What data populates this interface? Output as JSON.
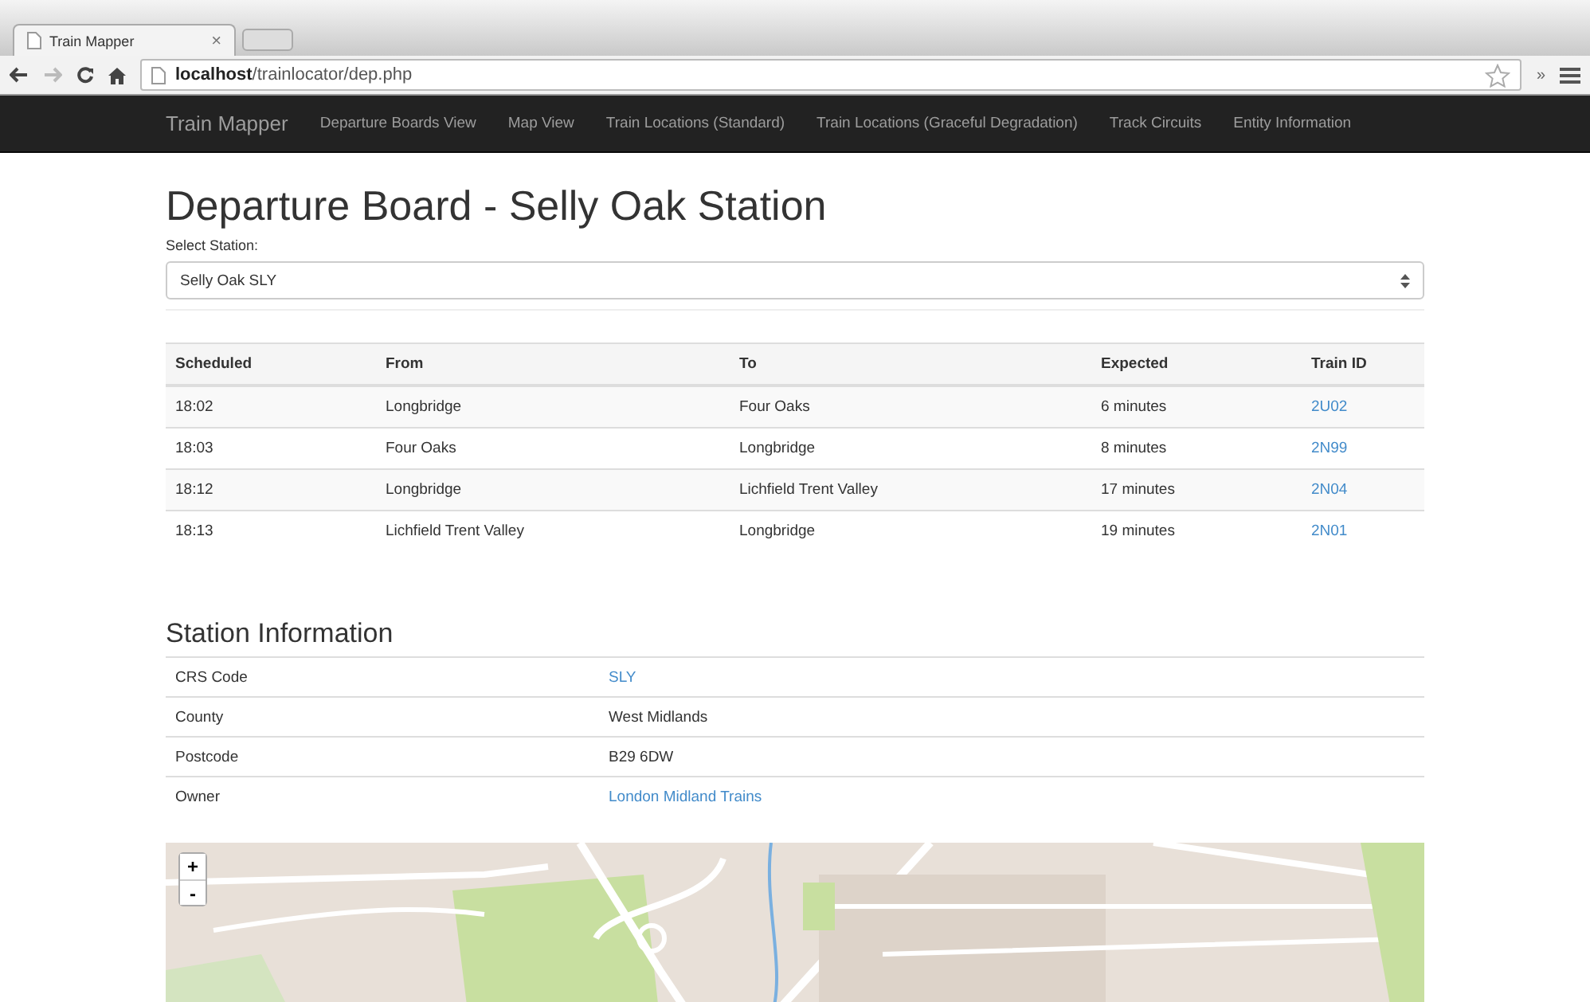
{
  "browser": {
    "tab_title": "Train Mapper",
    "tab_close": "×",
    "url_host": "localhost",
    "url_path": "/trainlocator/dep.php",
    "extensions": "»"
  },
  "navbar": {
    "brand": "Train Mapper",
    "links": [
      "Departure Boards View",
      "Map View",
      "Train Locations (Standard)",
      "Train Locations (Graceful Degradation)",
      "Track Circuits",
      "Entity Information"
    ]
  },
  "title": "Departure Board - Selly Oak Station",
  "station_select": {
    "label": "Select Station:",
    "value": "Selly Oak SLY"
  },
  "departures": {
    "columns": [
      "Scheduled",
      "From",
      "To",
      "Expected",
      "Train ID"
    ],
    "rows": [
      {
        "scheduled": "18:02",
        "from": "Longbridge",
        "to": "Four Oaks",
        "expected": "6 minutes",
        "train_id": "2U02"
      },
      {
        "scheduled": "18:03",
        "from": "Four Oaks",
        "to": "Longbridge",
        "expected": "8 minutes",
        "train_id": "2N99"
      },
      {
        "scheduled": "18:12",
        "from": "Longbridge",
        "to": "Lichfield Trent Valley",
        "expected": "17 minutes",
        "train_id": "2N04"
      },
      {
        "scheduled": "18:13",
        "from": "Lichfield Trent Valley",
        "to": "Longbridge",
        "expected": "19 minutes",
        "train_id": "2N01"
      }
    ]
  },
  "station_info": {
    "heading": "Station Information",
    "rows": [
      {
        "label": "CRS Code",
        "value": "SLY",
        "kind": "link"
      },
      {
        "label": "County",
        "value": "West Midlands",
        "kind": "text"
      },
      {
        "label": "Postcode",
        "value": "B29 6DW",
        "kind": "text"
      },
      {
        "label": "Owner",
        "value": "London Midland Trains",
        "kind": "link"
      }
    ]
  },
  "map": {
    "kind": "picture",
    "zoom_in": "+",
    "zoom_out": "-"
  }
}
